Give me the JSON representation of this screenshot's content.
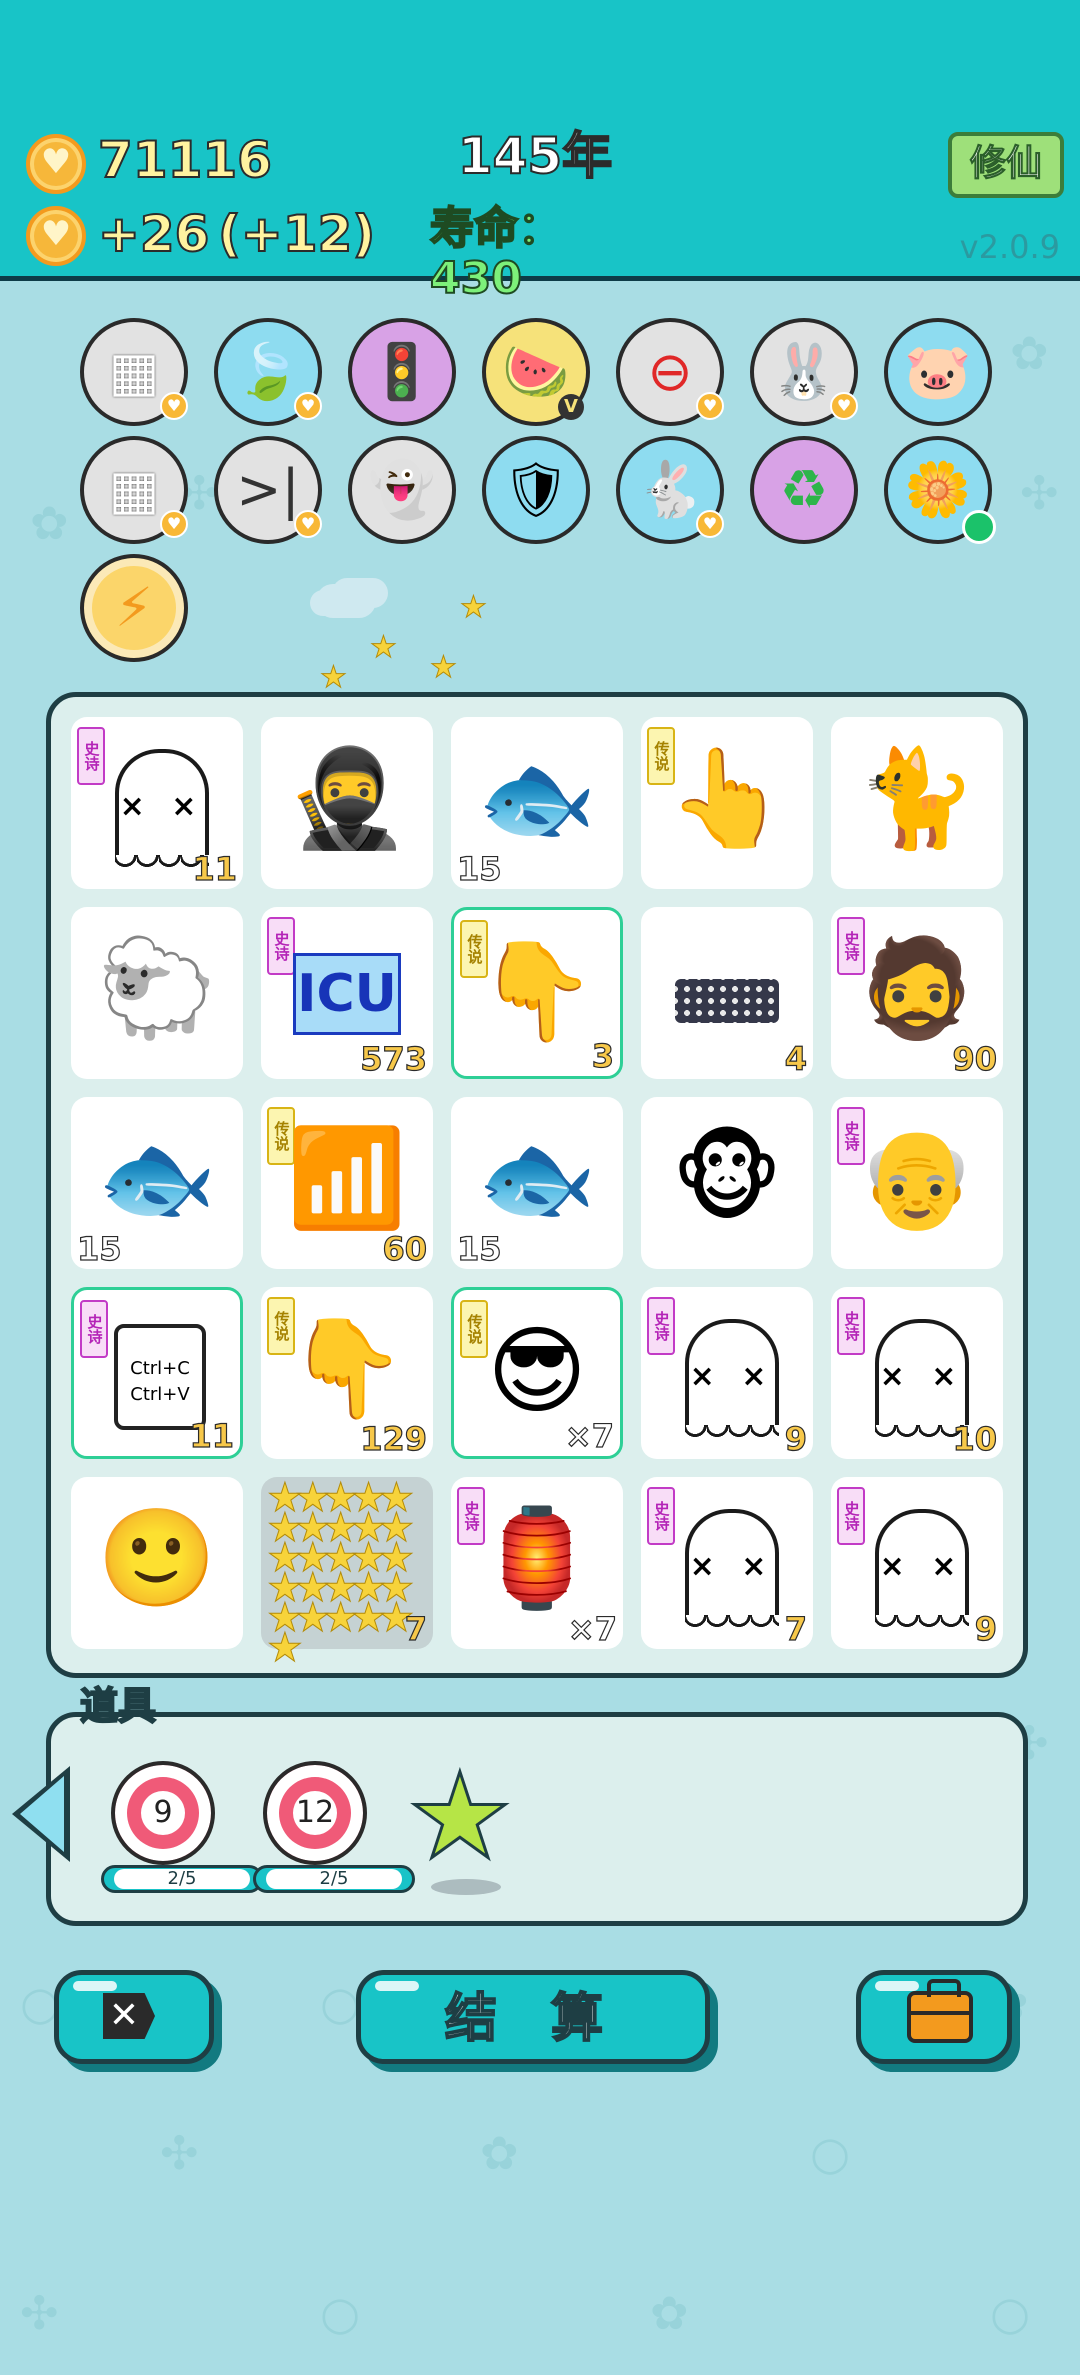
{
  "header": {
    "coins": "71116",
    "income": "+26",
    "bonus": "(+12)",
    "year": "145年",
    "lifespan_label": "寿命：",
    "lifespan_value": "430",
    "cultivate_button": "修仙",
    "version": "v2.0.9"
  },
  "skills": [
    {
      "icon": "cubes-icon",
      "glyph": "▦"
    },
    {
      "icon": "leaf-icon",
      "glyph": "🍃"
    },
    {
      "icon": "traffic-light-ghost-icon",
      "glyph": "🚦"
    },
    {
      "icon": "fruit-bowl-icon",
      "glyph": "🍉"
    },
    {
      "icon": "no-entry-icon",
      "glyph": "⛔"
    },
    {
      "icon": "rabbit-icon",
      "glyph": "🐰"
    },
    {
      "icon": "piggy-bank-icon",
      "glyph": "🐷"
    },
    {
      "icon": "cubes-icon",
      "glyph": "▦"
    },
    {
      "icon": "skip-icon",
      "glyph": "⏭"
    },
    {
      "icon": "winking-ghost-icon",
      "glyph": "👻"
    },
    {
      "icon": "shield-wrench-icon",
      "glyph": "🛡"
    },
    {
      "icon": "rabbit-icon",
      "glyph": "🐇"
    },
    {
      "icon": "recycle-icon",
      "glyph": "♻"
    },
    {
      "icon": "potted-flower-icon",
      "glyph": "🌼"
    },
    {
      "icon": "lightning-icon",
      "glyph": "⚡"
    }
  ],
  "tags": {
    "epic": "史诗",
    "legend": "传说"
  },
  "board": [
    {
      "name": "ghost",
      "tag": "史诗",
      "count": "11"
    },
    {
      "name": "thief",
      "glyph": "🥷",
      "count": ""
    },
    {
      "name": "fish",
      "glyph": "🐟",
      "count": "15",
      "left": true
    },
    {
      "name": "pointing-hand",
      "tag": "传说",
      "glyph": "👆",
      "count": ""
    },
    {
      "name": "cat",
      "glyph": "🐈",
      "count": ""
    },
    {
      "name": "sheep",
      "glyph": "🐑",
      "count": ""
    },
    {
      "name": "icu",
      "tag": "史诗",
      "text": "ICU",
      "count": "573"
    },
    {
      "name": "pointing-down-hand",
      "tag": "传说",
      "glyph": "👇",
      "count": "3",
      "highlight": true
    },
    {
      "name": "keyboard",
      "count": "4"
    },
    {
      "name": "bearded-man",
      "tag": "史诗",
      "glyph": "🧔",
      "count": "90"
    },
    {
      "name": "fish",
      "glyph": "🐟",
      "count": "15",
      "left": true
    },
    {
      "name": "wifi",
      "tag": "传说",
      "glyph": "📶",
      "count": "60"
    },
    {
      "name": "fish",
      "glyph": "🐟",
      "count": "15",
      "left": true
    },
    {
      "name": "monkey",
      "glyph": "🐵",
      "count": ""
    },
    {
      "name": "old-man",
      "tag": "史诗",
      "glyph": "👴",
      "count": ""
    },
    {
      "name": "ctrl-cv",
      "tag": "史诗",
      "text": "Ctrl+C\nCtrl+V",
      "count": "11",
      "highlight": true
    },
    {
      "name": "pointing-down-hand",
      "tag": "传说",
      "glyph": "👇",
      "count": "129"
    },
    {
      "name": "sunglasses-man",
      "tag": "传说",
      "glyph": "😎",
      "count": "×7",
      "highlight": true
    },
    {
      "name": "ghost",
      "tag": "史诗",
      "count": "9"
    },
    {
      "name": "ghost",
      "tag": "史诗",
      "count": "10"
    },
    {
      "name": "face",
      "glyph": "🙂",
      "count": ""
    },
    {
      "name": "star-burst",
      "count": "7",
      "selected": true
    },
    {
      "name": "rabbit-house",
      "tag": "史诗",
      "glyph": "🏮",
      "count": "×7"
    },
    {
      "name": "ghost",
      "tag": "史诗",
      "count": "7"
    },
    {
      "name": "ghost",
      "tag": "史诗",
      "count": "9"
    }
  ],
  "items": {
    "label": "道具",
    "list": [
      {
        "icon": "target-icon",
        "value": "9",
        "progress": "2/5"
      },
      {
        "icon": "target-icon",
        "value": "12",
        "progress": "2/5"
      },
      {
        "icon": "star-icon"
      }
    ]
  },
  "buttons": {
    "back": "back-button",
    "settle": "结 算",
    "bag": "bag-button"
  },
  "colors": {
    "topbar": "#18c4c7",
    "background": "#a9dde4",
    "board": "#dcefed",
    "epic_tag": "#c23bc6",
    "legend_tag": "#d8b415",
    "count": "#f7c84a"
  }
}
